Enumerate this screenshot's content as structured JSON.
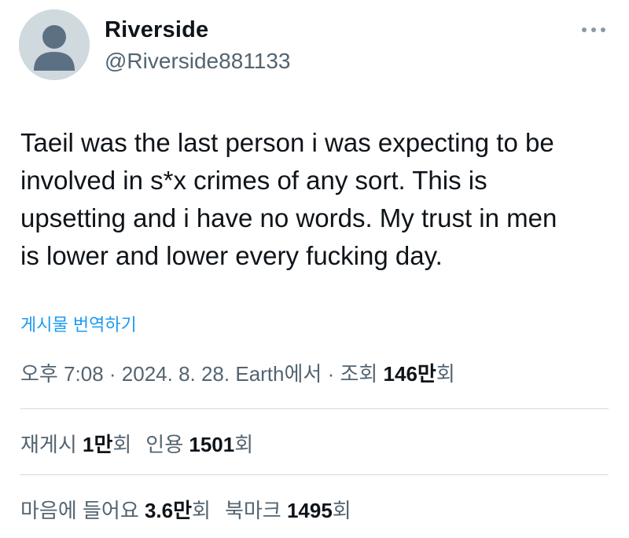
{
  "author": {
    "display_name": "Riverside",
    "handle": "@Riverside881133"
  },
  "more_icon": "more-horizontal-icon",
  "tweet": {
    "lines": [
      "Taeil was the last person i was expecting to be",
      "involved in s*x crimes of any sort. This is",
      "upsetting and i have no words. My trust in men",
      "is lower and lower every fucking day."
    ]
  },
  "translate_label": "게시물 번역하기",
  "meta": {
    "time": "오후 7:08",
    "sep1": " · ",
    "date": "2024. 8. 28.",
    "source": " Earth에서",
    "sep2": " · ",
    "views_label": "조회 ",
    "views_value": "146만",
    "views_unit": "회"
  },
  "stats_row1": {
    "reposts_label": "재게시 ",
    "reposts_value": "1만",
    "reposts_unit": "회",
    "quotes_label": "인용 ",
    "quotes_value": "1501",
    "quotes_unit": "회"
  },
  "stats_row2": {
    "likes_label": "마음에 들어요 ",
    "likes_value": "3.6만",
    "likes_unit": "회",
    "bookmarks_label": "북마크 ",
    "bookmarks_value": "1495",
    "bookmarks_unit": "회"
  },
  "colors": {
    "text_primary": "#0f1419",
    "text_secondary": "#536471",
    "link_blue": "#1d9bf0",
    "divider": "#cfd9de",
    "avatar_bg": "#cfd9de",
    "avatar_fg": "#5b7083"
  }
}
